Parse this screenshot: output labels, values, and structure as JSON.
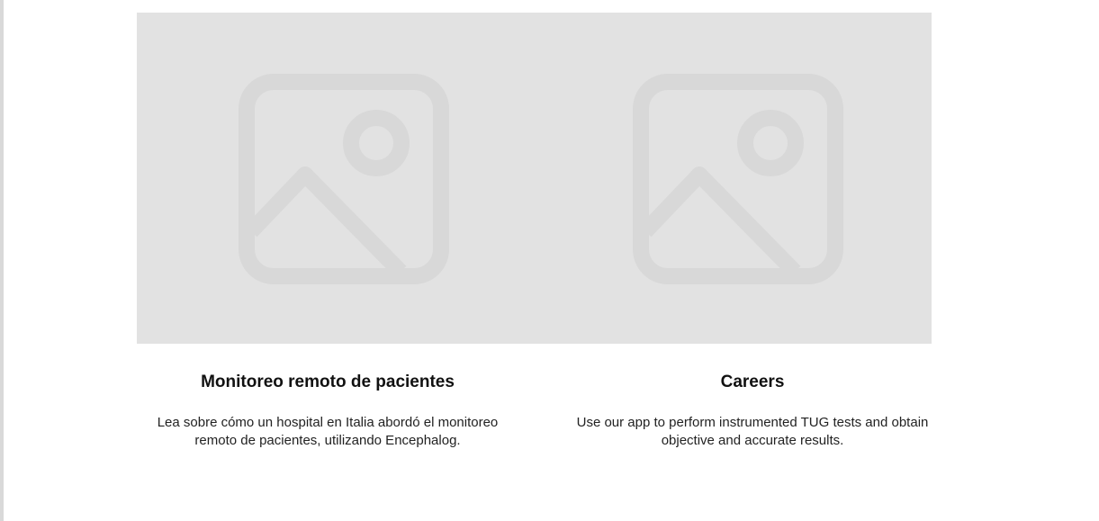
{
  "images": [
    {
      "icon": "image-placeholder-icon"
    },
    {
      "icon": "image-placeholder-icon"
    }
  ],
  "cards": [
    {
      "title": "Monitoreo remoto de pacientes",
      "text": "Lea sobre cómo un hospital en Italia abordó el monitoreo remoto de pacientes, utilizando Encephalog."
    },
    {
      "title": "Careers",
      "text": "Use our app to perform instrumented TUG tests and obtain objective and accurate results."
    }
  ],
  "colors": {
    "placeholder_bg": "#e2e2e2",
    "placeholder_icon": "#d8d8d8",
    "text": "#111111"
  }
}
